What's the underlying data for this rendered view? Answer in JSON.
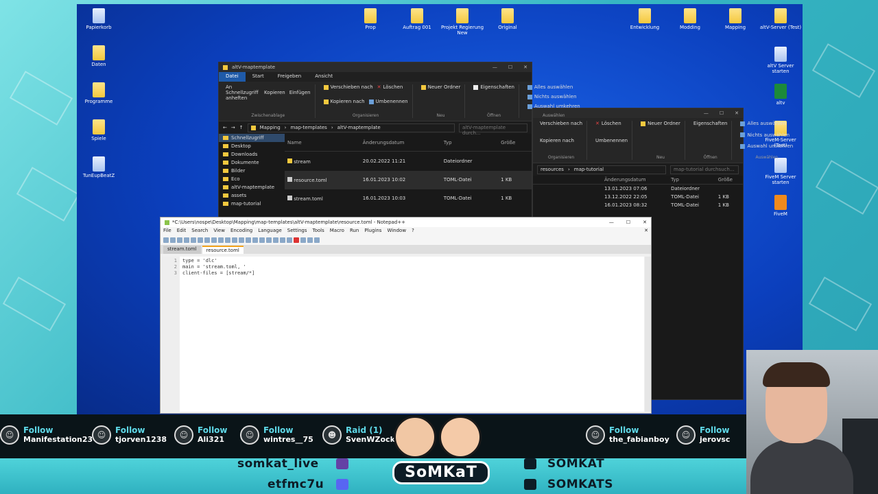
{
  "desktop": {
    "icons": [
      {
        "label": "Papierkorb",
        "kind": "app"
      },
      {
        "label": "Daten",
        "kind": "folder"
      },
      {
        "label": "Programme",
        "kind": "folder"
      },
      {
        "label": "Spiele",
        "kind": "folder"
      },
      {
        "label": "TunEupBeatZ",
        "kind": "app"
      },
      {
        "label": "Prop",
        "kind": "folder"
      },
      {
        "label": "Auftrag 001",
        "kind": "folder"
      },
      {
        "label": "Projekt Regierung New",
        "kind": "folder"
      },
      {
        "label": "Original",
        "kind": "folder"
      },
      {
        "label": "Entwicklung",
        "kind": "folder"
      },
      {
        "label": "Modding",
        "kind": "folder"
      },
      {
        "label": "Mapping",
        "kind": "folder"
      },
      {
        "label": "altV-Server (Test)",
        "kind": "folder"
      },
      {
        "label": "altV Server starten",
        "kind": "app"
      },
      {
        "label": "altv",
        "kind": "app"
      },
      {
        "label": "FiveM-Server (Test)",
        "kind": "folder"
      },
      {
        "label": "FiveM Server starten",
        "kind": "app"
      },
      {
        "label": "FiveM",
        "kind": "app"
      }
    ]
  },
  "explorer_front": {
    "title": "altV-maptemplate",
    "tabs": [
      "Datei",
      "Start",
      "Freigeben",
      "Ansicht"
    ],
    "ribbon": {
      "pin": "An Schnellzugriff anheften",
      "copy": "Kopieren",
      "paste": "Einfügen",
      "clipboard_group": "Zwischenablage",
      "move": "Verschieben nach",
      "copy_to": "Kopieren nach",
      "delete": "Löschen",
      "rename": "Umbenennen",
      "organize_group": "Organisieren",
      "new_folder": "Neuer Ordner",
      "new_group": "Neu",
      "properties": "Eigenschaften",
      "open_group": "Öffnen",
      "select_all": "Alles auswählen",
      "select_none": "Nichts auswählen",
      "invert": "Auswahl umkehren",
      "select_group": "Auswählen"
    },
    "path": [
      "Mapping",
      "map-templates",
      "altV-maptemplate"
    ],
    "search_placeholder": "altV-maptemplate durch...",
    "columns": [
      "Name",
      "Änderungsdatum",
      "Typ",
      "Größe"
    ],
    "files": [
      {
        "name": "stream",
        "date": "20.02.2022 11:21",
        "type": "Dateiordner",
        "size": ""
      },
      {
        "name": "resource.toml",
        "date": "16.01.2023 10:02",
        "type": "TOML-Datei",
        "size": "1 KB"
      },
      {
        "name": "stream.toml",
        "date": "16.01.2023 10:03",
        "type": "TOML-Datei",
        "size": "1 KB"
      }
    ],
    "nav": [
      "Schnellzugriff",
      "Desktop",
      "Downloads",
      "Dokumente",
      "Bilder",
      "Eco",
      "altV-maptemplate",
      "assets",
      "map-tutorial"
    ]
  },
  "explorer_back": {
    "ribbon": {
      "move": "Verschieben nach",
      "copy_to": "Kopieren nach",
      "delete": "Löschen",
      "rename": "Umbenennen",
      "organize_group": "Organisieren",
      "new_folder": "Neuer Ordner",
      "new_group": "Neu",
      "properties": "Eigenschaften",
      "open_group": "Öffnen",
      "select_all": "Alles auswählen",
      "select_none": "Nichts auswählen",
      "invert": "Auswahl umkehren",
      "select_group": "Auswählen"
    },
    "path": [
      "resources",
      "map-tutorial"
    ],
    "search_placeholder": "map-tutorial durchsuch...",
    "columns": [
      "Änderungsdatum",
      "Typ",
      "Größe"
    ],
    "files": [
      {
        "date": "13.01.2023 07:06",
        "type": "Dateiordner",
        "size": ""
      },
      {
        "date": "13.12.2022 22:05",
        "type": "TOML-Datei",
        "size": "1 KB"
      },
      {
        "date": "16.01.2023 08:32",
        "type": "TOML-Datei",
        "size": "1 KB"
      }
    ]
  },
  "notepad": {
    "title": "*C:\\Users\\nospe\\Desktop\\Mapping\\map-templates\\altV-maptemplate\\resource.toml - Notepad++",
    "menu": [
      "File",
      "Edit",
      "Search",
      "View",
      "Encoding",
      "Language",
      "Settings",
      "Tools",
      "Macro",
      "Run",
      "Plugins",
      "Window",
      "?"
    ],
    "tabs": [
      "stream.toml",
      "resource.toml"
    ],
    "lines": [
      {
        "no": "1",
        "text": "type = 'dlc'"
      },
      {
        "no": "2",
        "text": "main = 'stream.toml, '"
      },
      {
        "no": "3",
        "text": "client-files = [stream/*]"
      }
    ]
  },
  "alerts": [
    {
      "kind": "Follow",
      "who": "Manifestation23"
    },
    {
      "kind": "Follow",
      "who": "tjorven1238"
    },
    {
      "kind": "Follow",
      "who": "Ali321"
    },
    {
      "kind": "Follow",
      "who": "wintres__75"
    },
    {
      "kind": "Raid (1)",
      "who": "SvenWZockt"
    },
    {
      "kind": "Follow",
      "who": "the_fabianboy"
    },
    {
      "kind": "Follow",
      "who": "jerovsc"
    },
    {
      "kind": "Follow",
      "who": ""
    }
  ],
  "socials": {
    "twitch": "somkat_live",
    "discord": "etfmc7u",
    "youtube": "SOMKAT",
    "twitter": "SOMKATS"
  },
  "logo_text": "SoMKaT",
  "colors": {
    "desktop_blue": "#0b3fbd",
    "frame_teal": "#3ec6cf",
    "alert_accent": "#5fd9e8"
  }
}
